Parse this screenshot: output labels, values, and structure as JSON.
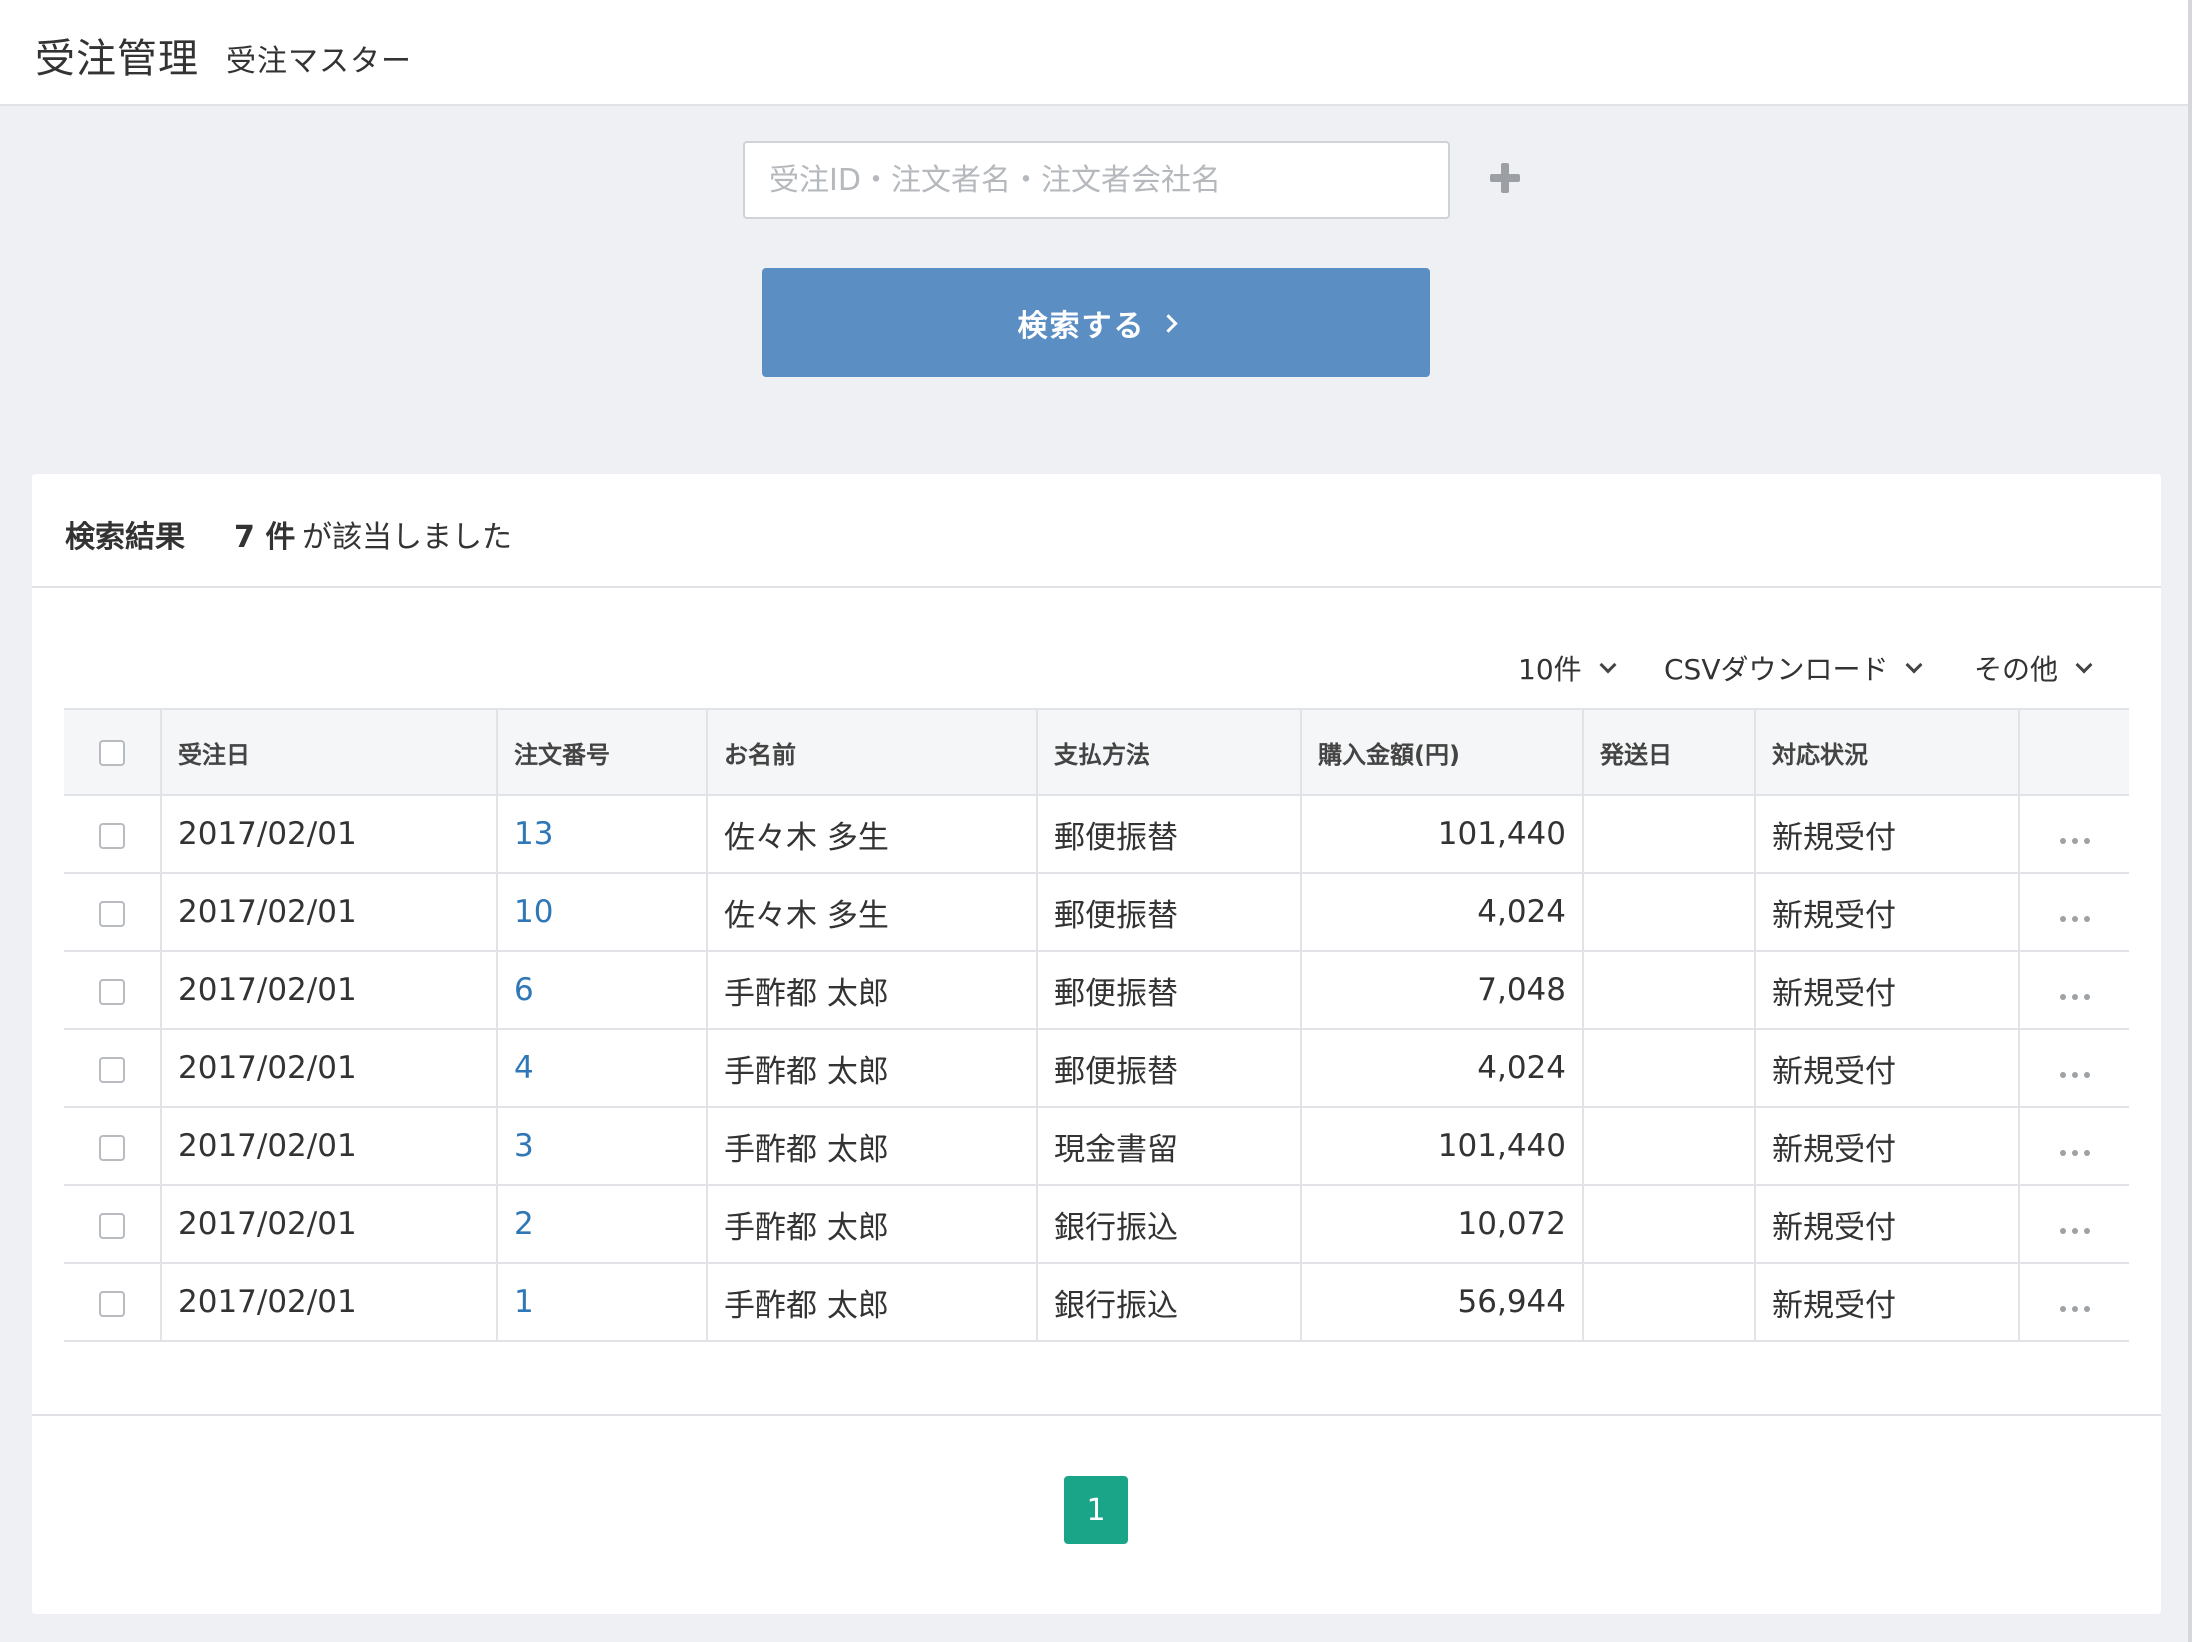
{
  "header": {
    "title": "受注管理",
    "subtitle": "受注マスター"
  },
  "search": {
    "placeholder": "受注ID・注文者名・注文者会社名",
    "value": "",
    "button_label": "検索する"
  },
  "results": {
    "label": "検索結果",
    "count": "7 件",
    "suffix": "が該当しました"
  },
  "toolbar": {
    "per_page": "10件",
    "csv": "CSVダウンロード",
    "other": "その他"
  },
  "table": {
    "columns": [
      "受注日",
      "注文番号",
      "お名前",
      "支払方法",
      "購入金額(円)",
      "発送日",
      "対応状況"
    ],
    "rows": [
      {
        "date": "2017/02/01",
        "order_no": "13",
        "name": "佐々木 多生",
        "payment": "郵便振替",
        "amount": "101,440",
        "ship_date": "",
        "status": "新規受付"
      },
      {
        "date": "2017/02/01",
        "order_no": "10",
        "name": "佐々木 多生",
        "payment": "郵便振替",
        "amount": "4,024",
        "ship_date": "",
        "status": "新規受付"
      },
      {
        "date": "2017/02/01",
        "order_no": "6",
        "name": "手酢都 太郎",
        "payment": "郵便振替",
        "amount": "7,048",
        "ship_date": "",
        "status": "新規受付"
      },
      {
        "date": "2017/02/01",
        "order_no": "4",
        "name": "手酢都 太郎",
        "payment": "郵便振替",
        "amount": "4,024",
        "ship_date": "",
        "status": "新規受付"
      },
      {
        "date": "2017/02/01",
        "order_no": "3",
        "name": "手酢都 太郎",
        "payment": "現金書留",
        "amount": "101,440",
        "ship_date": "",
        "status": "新規受付"
      },
      {
        "date": "2017/02/01",
        "order_no": "2",
        "name": "手酢都 太郎",
        "payment": "銀行振込",
        "amount": "10,072",
        "ship_date": "",
        "status": "新規受付"
      },
      {
        "date": "2017/02/01",
        "order_no": "1",
        "name": "手酢都 太郎",
        "payment": "銀行振込",
        "amount": "56,944",
        "ship_date": "",
        "status": "新規受付"
      }
    ]
  },
  "pagination": {
    "current": "1"
  },
  "colors": {
    "primary_button": "#5b8fc4",
    "link": "#2f77b6",
    "page_active": "#1aa588",
    "background": "#eff0f3"
  },
  "icons": {
    "add": "plus-icon",
    "submit": "chevron-right-icon",
    "dropdown": "chevron-down-icon",
    "row_menu": "more-horizontal-icon"
  }
}
